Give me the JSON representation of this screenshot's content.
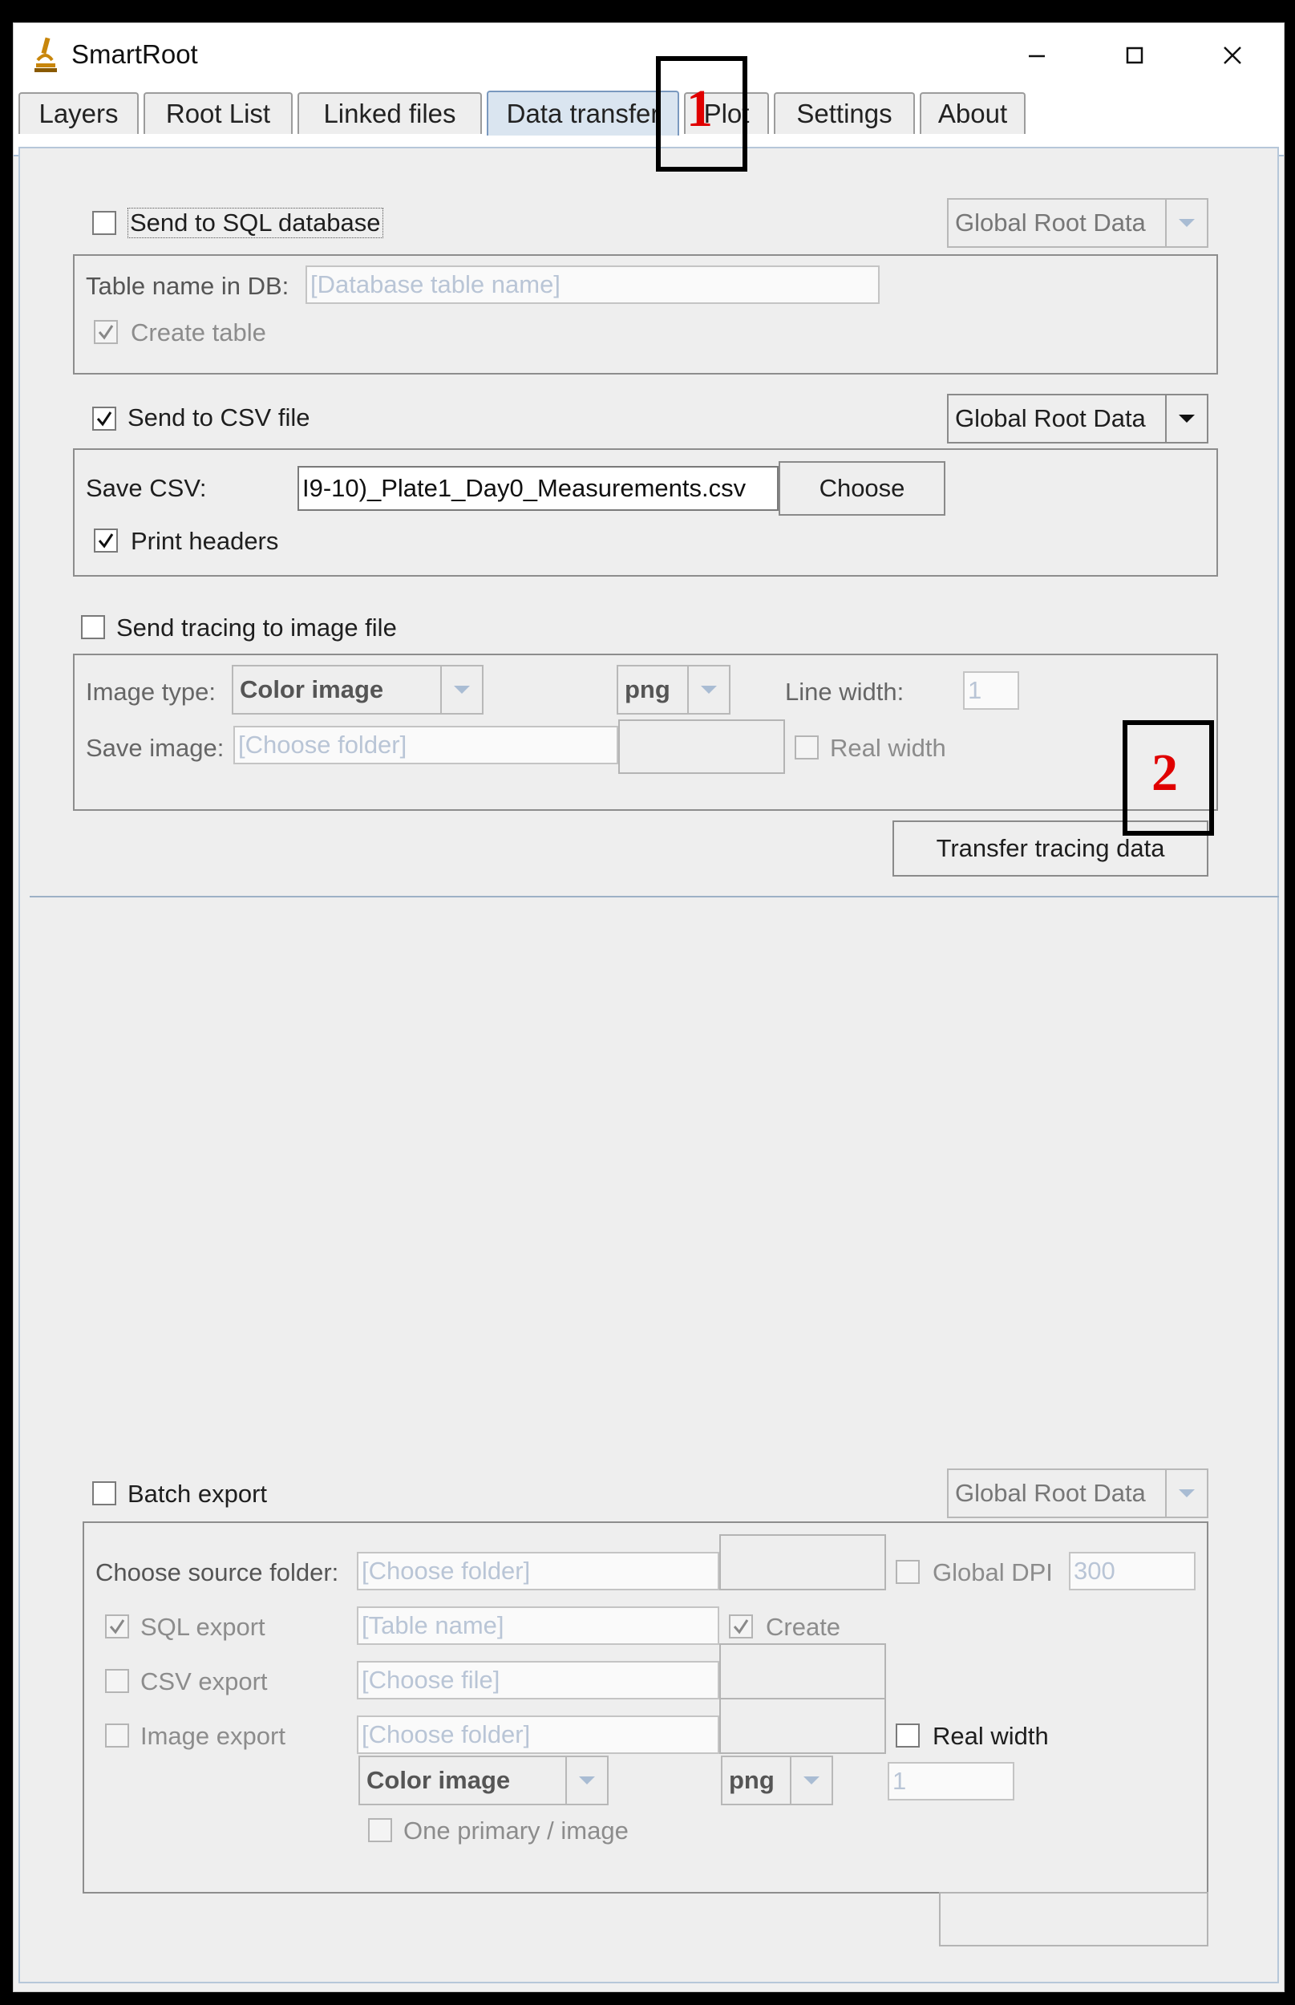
{
  "window": {
    "title": "SmartRoot"
  },
  "tabs": [
    {
      "label": "Layers",
      "active": false
    },
    {
      "label": "Root List",
      "active": false
    },
    {
      "label": "Linked files",
      "active": false
    },
    {
      "label": "Data transfer",
      "active": true
    },
    {
      "label": "Plot",
      "active": false
    },
    {
      "label": "Settings",
      "active": false
    },
    {
      "label": "About",
      "active": false
    }
  ],
  "sql": {
    "checkbox_label": "Send to SQL database",
    "checked": false,
    "combo_value": "Global Root Data",
    "table_label": "Table name in DB:",
    "table_placeholder": "[Database table name]",
    "create_label": "Create table",
    "create_checked": true
  },
  "csv": {
    "checkbox_label": "Send to CSV file",
    "checked": true,
    "combo_value": "Global Root Data",
    "save_label": "Save CSV:",
    "save_value": "I9-10)_Plate1_Day0_Measurements.csv",
    "choose_label": "Choose",
    "headers_label": "Print headers",
    "headers_checked": true
  },
  "image": {
    "checkbox_label": "Send tracing to image file",
    "checked": false,
    "type_label": "Image type:",
    "type_value": "Color image",
    "format_value": "png",
    "line_width_label": "Line width:",
    "line_width_value": "1",
    "save_label": "Save image:",
    "save_placeholder": "[Choose folder]",
    "real_width_label": "Real width"
  },
  "transfer_button": "Transfer tracing data",
  "batch": {
    "checkbox_label": "Batch export",
    "combo_value": "Global Root Data",
    "source_label": "Choose source folder:",
    "source_placeholder": "[Choose folder]",
    "global_dpi_label": "Global DPI",
    "global_dpi_value": "300",
    "sql_label": "SQL export",
    "sql_checked": true,
    "sql_placeholder": "[Table name]",
    "create_label": "Create",
    "create_checked": true,
    "csv_label": "CSV export",
    "csv_placeholder": "[Choose file]",
    "image_label": "Image export",
    "image_placeholder": "[Choose folder]",
    "real_width_label": "Real width",
    "type_value": "Color image",
    "format_value": "png",
    "line_width_value": "1",
    "one_primary_label": "One primary / image"
  },
  "annotations": {
    "first": "1",
    "second": "2"
  },
  "colors": {
    "annotation_number": "#e00000",
    "active_tab": "#dae5f0"
  }
}
